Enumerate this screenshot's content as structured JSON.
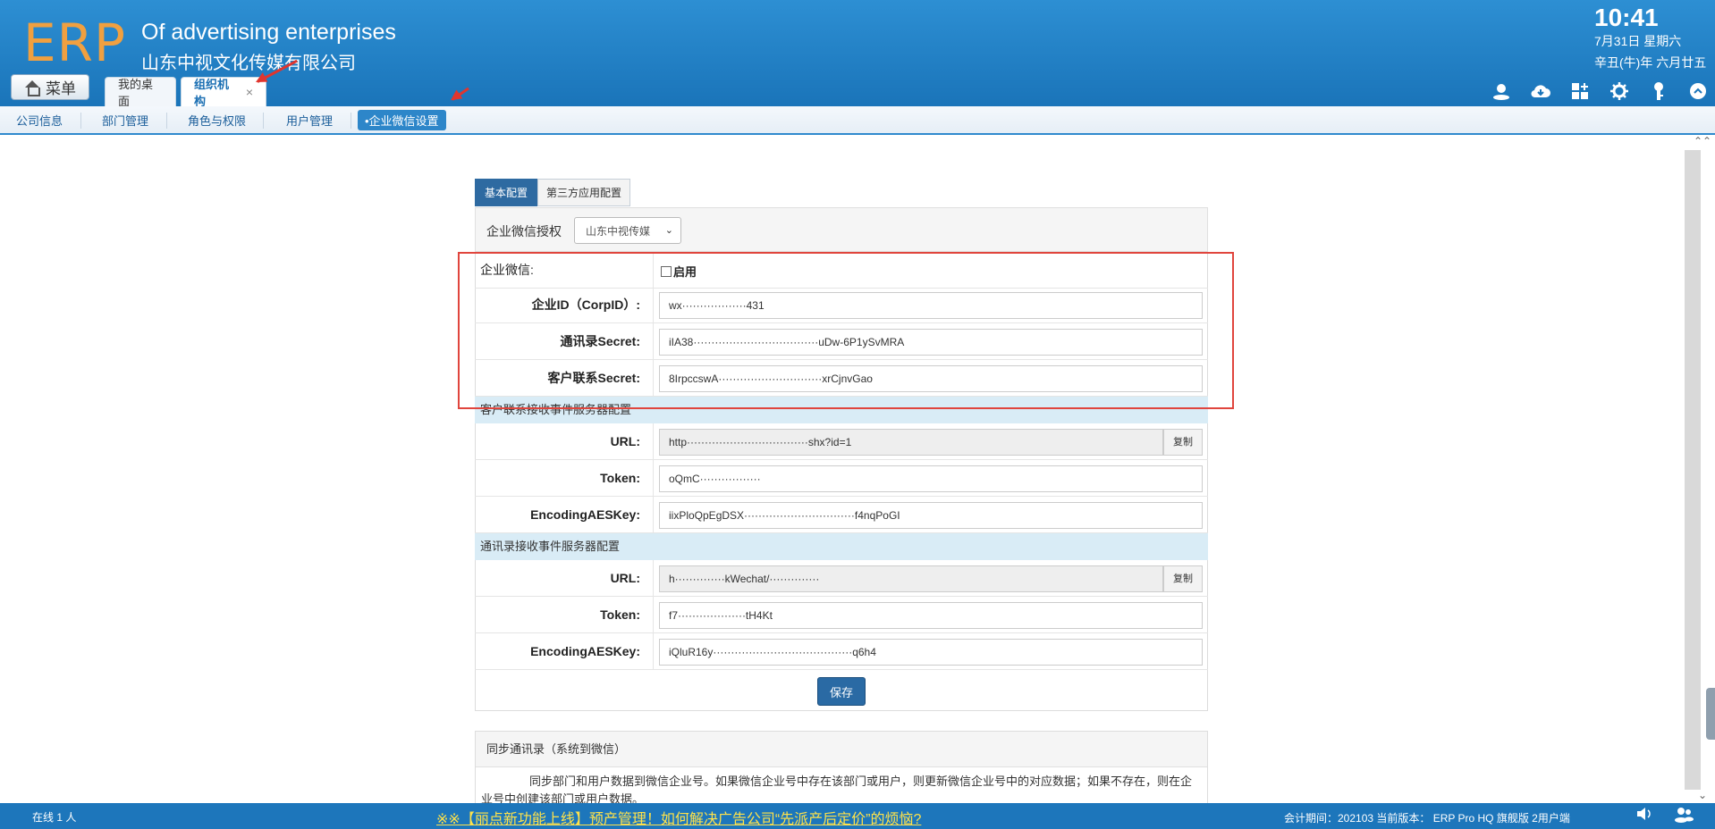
{
  "header": {
    "logo": "ERP",
    "title_en": "Of advertising enterprises",
    "title_cn": "山东中视文化传媒有限公司",
    "clock": "10:41",
    "date": "7月31日 星期六",
    "lunar": "辛丑(牛)年 六月廿五",
    "menu_label": "菜单",
    "tabs": [
      {
        "label": "我的桌面",
        "close": ""
      },
      {
        "label": "组织机构",
        "close": "×"
      }
    ],
    "tray_icons": [
      "user-icon",
      "cloud-icon",
      "grid-add-icon",
      "gear-icon",
      "key-icon",
      "collapse-icon"
    ]
  },
  "subnav": {
    "items": [
      "公司信息",
      "部门管理",
      "角色与权限",
      "用户管理",
      "•企业微信设置"
    ]
  },
  "config_tabs": [
    "基本配置",
    "第三方应用配置"
  ],
  "auth": {
    "label": "企业微信授权",
    "selected": "山东中视传媒"
  },
  "form": {
    "enable_label": "企业微信:",
    "enable_option": "启用",
    "corpid_label": "企业ID（CorpID）:",
    "corpid_value": "wx··················431",
    "contact_secret_label": "通讯录Secret:",
    "contact_secret_value": "iIA38···································uDw-6P1ySvMRA",
    "customer_secret_label": "客户联系Secret:",
    "customer_secret_value": "8IrpccswA·····························xrCjnvGao",
    "customer_section": "客户联系接收事件服务器配置",
    "url_label": "URL:",
    "customer_url": "http··································shx?id=1",
    "copy_label": "复制",
    "token_label": "Token:",
    "customer_token": "oQmC·················",
    "aes_label": "EncodingAESKey:",
    "customer_aes": "iixPloQpEgDSX·······························f4nqPoGI",
    "contact_section": "通讯录接收事件服务器配置",
    "contact_url": "h··············kWechat/··············",
    "contact_token": "f7···················tH4Kt",
    "contact_aes": "iQluR16y·······································q6h4",
    "save_label": "保存"
  },
  "sync": {
    "title": "同步通讯录（系统到微信）",
    "body": "同步部门和用户数据到微信企业号。如果微信企业号中存在该部门或用户，则更新微信企业号中的对应数据；如果不存在，则在企业号中创建该部门或用户数据。"
  },
  "footer": {
    "online_text": "在线  1  人",
    "notice": "※※【丽点新功能上线】预产管理！如何解决广告公司“先派产后定价”的烦恼?",
    "info": "会计期间：202103 当前版本： ERP Pro HQ 旗舰版 2用户端"
  },
  "colors": {
    "header_blue": "#1a74b9",
    "accent_orange": "#f0a040",
    "highlight_red": "#e0453d",
    "notice_yellow": "#ffe24a"
  }
}
